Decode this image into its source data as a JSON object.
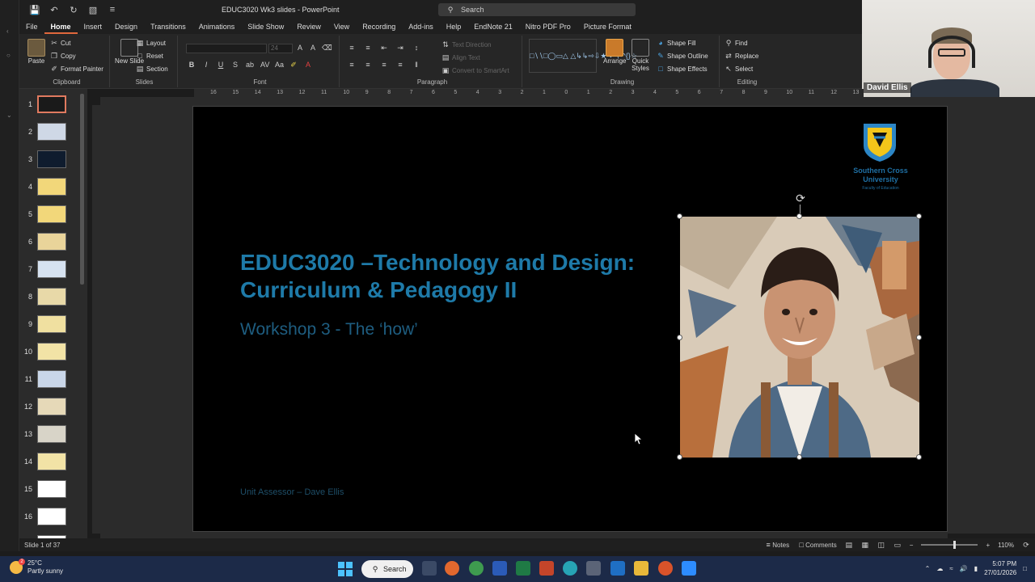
{
  "window": {
    "doc_title": "EDUC3020 Wk3 slides - PowerPoint",
    "search_label": "Search"
  },
  "tabs": [
    "File",
    "Home",
    "Insert",
    "Design",
    "Transitions",
    "Animations",
    "Slide Show",
    "Review",
    "View",
    "Recording",
    "Add-ins",
    "Help",
    "EndNote 21",
    "Nitro PDF Pro",
    "Picture Format"
  ],
  "ribbon": {
    "clipboard": {
      "paste": "Paste",
      "cut": "Cut",
      "copy": "Copy",
      "format_painter": "Format Painter",
      "label": "Clipboard"
    },
    "slides": {
      "new_slide": "New Slide",
      "layout": "Layout",
      "reset": "Reset",
      "section": "Section",
      "label": "Slides"
    },
    "font": {
      "size": "24",
      "label": "Font"
    },
    "paragraph": {
      "text_direction": "Text Direction",
      "align_text": "Align Text",
      "convert_smartart": "Convert to SmartArt",
      "label": "Paragraph"
    },
    "drawing": {
      "arrange": "Arrange",
      "quick_styles": "Quick Styles",
      "shape_fill": "Shape Fill",
      "shape_outline": "Shape Outline",
      "shape_effects": "Shape Effects",
      "label": "Drawing"
    },
    "editing": {
      "find": "Find",
      "replace": "Replace",
      "select": "Select",
      "label": "Editing"
    }
  },
  "presenter": {
    "name": "David Ellis"
  },
  "thumbnails": [
    "1",
    "2",
    "3",
    "4",
    "5",
    "6",
    "7",
    "8",
    "9",
    "10",
    "11",
    "12",
    "13",
    "14",
    "15",
    "16",
    "17"
  ],
  "ruler_ticks": [
    "16",
    "15",
    "14",
    "13",
    "12",
    "11",
    "10",
    "9",
    "8",
    "7",
    "6",
    "5",
    "4",
    "3",
    "2",
    "1",
    "0",
    "1",
    "2",
    "3",
    "4",
    "5",
    "6",
    "7",
    "8",
    "9",
    "10",
    "11",
    "12",
    "13"
  ],
  "slide": {
    "title_line1": "EDUC3020 –Technology and Design:",
    "title_line2": "Curriculum & Pedagogy II",
    "subtitle": "Workshop 3 -  The ‘how’",
    "footer": "Unit Assessor – Dave Ellis",
    "logo_name_line1": "Southern Cross",
    "logo_name_line2": "University",
    "logo_faculty": "Faculty of Education"
  },
  "status": {
    "slide_count": "Slide 1 of 37",
    "notes": "Notes",
    "comments": "Comments",
    "zoom": "110%"
  },
  "taskbar": {
    "temp": "25°C",
    "weather": "Partly sunny",
    "search": "Search",
    "time": "5:07 PM",
    "date": "27/01/2026"
  },
  "colors": {
    "accent_tab": "#e0683c",
    "title_blue": "#1e7aa8",
    "taskbar": "#1c2a48"
  }
}
